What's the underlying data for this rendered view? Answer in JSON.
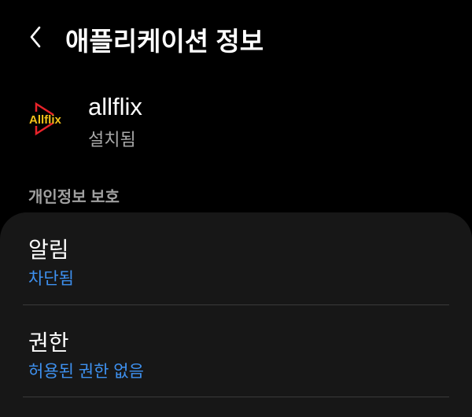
{
  "header": {
    "title": "애플리케이션 정보",
    "back_icon": "chevron-left-icon"
  },
  "app": {
    "name": "allflix",
    "status": "설치됨",
    "logo_text": "Allflix"
  },
  "section": {
    "title": "개인정보 보호"
  },
  "items": [
    {
      "title": "알림",
      "subtitle": "차단됨"
    },
    {
      "title": "권한",
      "subtitle": "허용된 권한 없음"
    }
  ],
  "colors": {
    "accent": "#3e91f0",
    "card": "#171717",
    "logo_red": "#e8232a",
    "logo_yellow": "#f2c21a"
  }
}
